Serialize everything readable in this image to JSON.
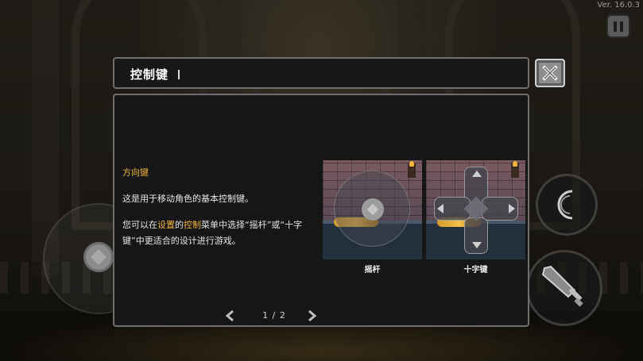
{
  "hud": {
    "version": "Ver. 16.0.3"
  },
  "dialog": {
    "title": "控制键",
    "section_heading": "方向键",
    "para1": "这是用于移动角色的基本控制键。",
    "para2_parts": [
      "您可以在",
      "设置",
      "的",
      "控制",
      "菜单中选择“摇杆”或“十字键”中更适合的设计进行游戏。"
    ],
    "preview_joystick_caption": "摇杆",
    "preview_dpad_caption": "十字键",
    "page_indicator": "1 / 2"
  },
  "colors": {
    "highlight": "#f2b53a",
    "panel_bg": "#161616",
    "panel_border": "#6e6e6e"
  },
  "icons": [
    "pause-icon",
    "close-icon",
    "joystick-icon",
    "dpad-icon",
    "moon-skill-icon",
    "sword-attack-icon",
    "chevron-left-icon",
    "chevron-right-icon",
    "torch-icon"
  ]
}
